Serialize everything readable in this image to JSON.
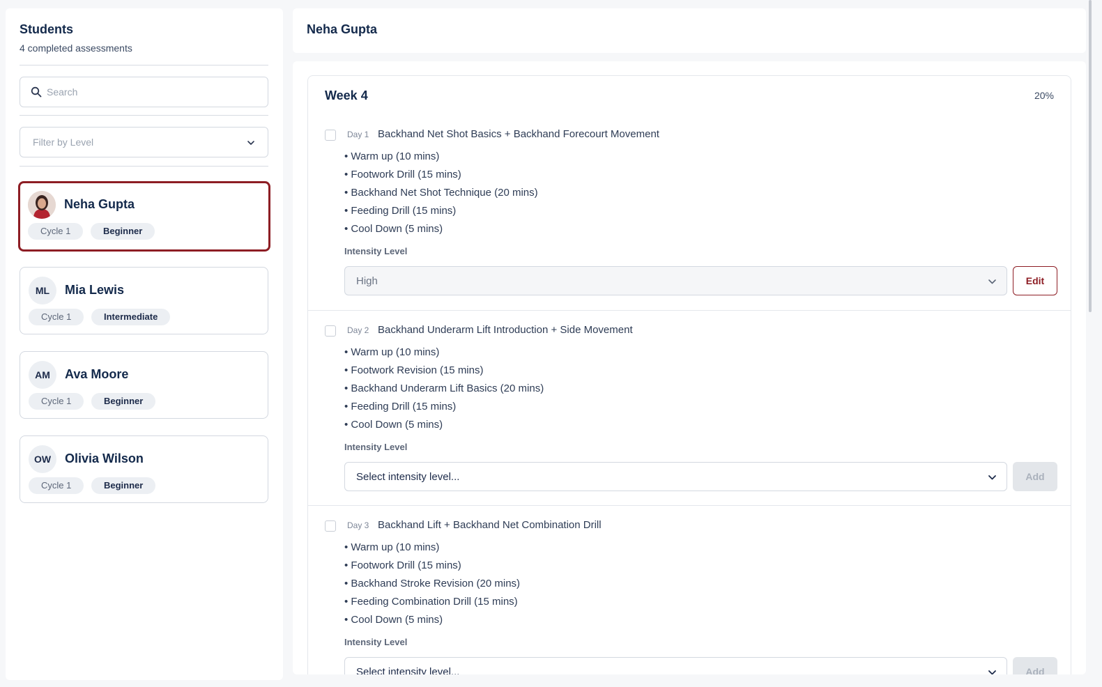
{
  "sidebar": {
    "title": "Students",
    "subtitle": "4 completed assessments",
    "search_placeholder": "Search",
    "filter_placeholder": "Filter by Level",
    "students": [
      {
        "name": "Neha Gupta",
        "initials": "",
        "cycle": "Cycle 1",
        "level": "Beginner",
        "active": true
      },
      {
        "name": "Mia Lewis",
        "initials": "ML",
        "cycle": "Cycle 1",
        "level": "Intermediate"
      },
      {
        "name": "Ava Moore",
        "initials": "AM",
        "cycle": "Cycle 1",
        "level": "Beginner"
      },
      {
        "name": "Olivia Wilson",
        "initials": "OW",
        "cycle": "Cycle 1",
        "level": "Beginner"
      }
    ]
  },
  "header": {
    "title": "Neha Gupta"
  },
  "week": {
    "title": "Week 4",
    "progress": "20%",
    "intensity_label": "Intensity Level",
    "days": [
      {
        "num": "Day 1",
        "title": "Backhand Net Shot Basics + Backhand Forecourt Movement",
        "activities": [
          "Warm up (10 mins)",
          "Footwork Drill (15 mins)",
          "Backhand Net Shot Technique (20 mins)",
          "Feeding Drill (15 mins)",
          "Cool Down (5 mins)"
        ],
        "intensity": "High",
        "action": "Edit"
      },
      {
        "num": "Day 2",
        "title": "Backhand Underarm Lift Introduction + Side Movement",
        "activities": [
          "Warm up (10 mins)",
          "Footwork Revision (15 mins)",
          "Backhand Underarm Lift Basics (20 mins)",
          "Feeding Drill (15 mins)",
          "Cool Down (5 mins)"
        ],
        "intensity": "Select intensity level...",
        "action": "Add"
      },
      {
        "num": "Day 3",
        "title": "Backhand Lift + Backhand Net Combination Drill",
        "activities": [
          "Warm up (10 mins)",
          "Footwork Drill (15 mins)",
          "Backhand Stroke Revision (20 mins)",
          "Feeding Combination Drill (15 mins)",
          "Cool Down (5 mins)"
        ],
        "intensity": "Select intensity level...",
        "action": "Add"
      }
    ]
  },
  "colors": {
    "accent": "#8d1d24",
    "heading": "#13294b"
  },
  "icons": {
    "search": "search-icon",
    "dropdown": "chevron-down-icon"
  }
}
